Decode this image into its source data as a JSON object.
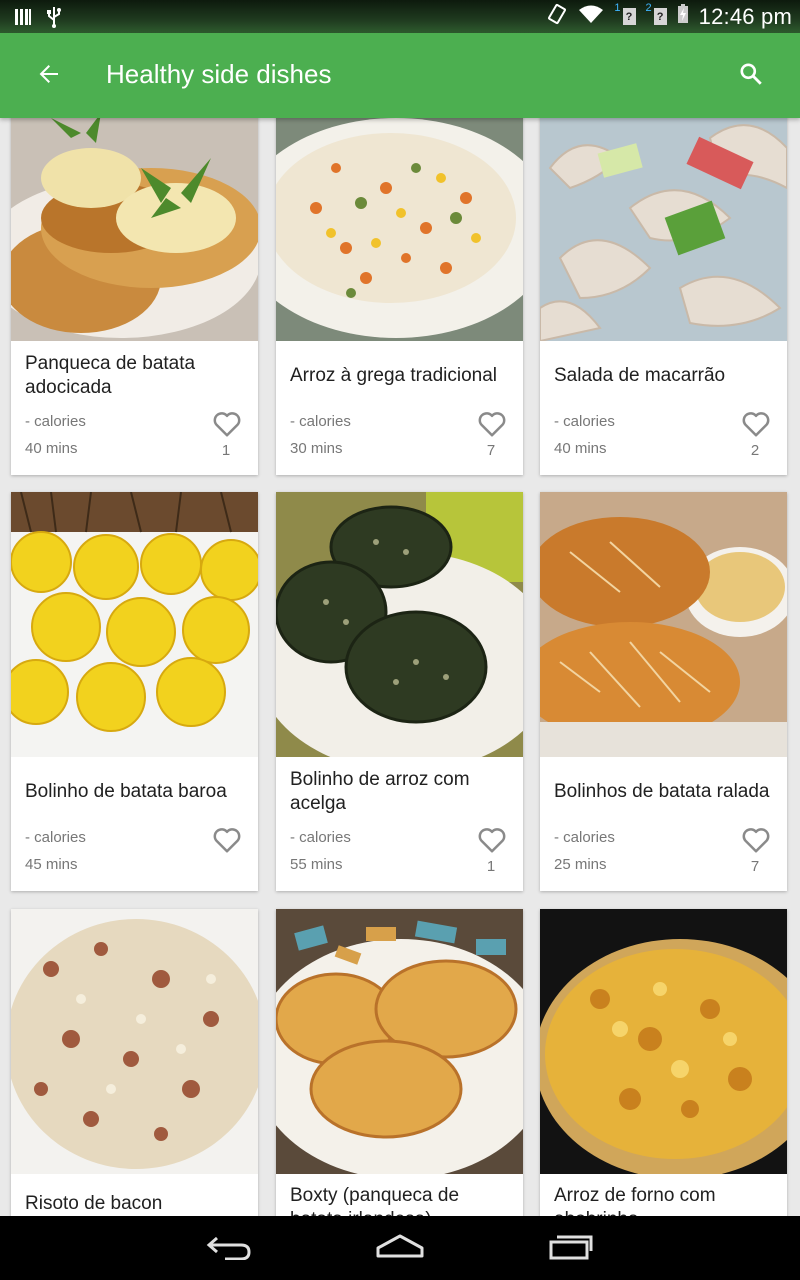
{
  "status_bar": {
    "time": "12:46 pm",
    "sim1": "1",
    "sim2": "2",
    "unknown": "?"
  },
  "app_bar": {
    "title": "Healthy side dishes",
    "back_icon": "arrow-back-icon",
    "search_icon": "search-icon"
  },
  "colors": {
    "primary": "#4caf50",
    "status_bar": "#1f3a1f",
    "card_bg": "#ffffff",
    "background": "#e9e9e9"
  },
  "recipes": [
    {
      "name": "Panqueca de batata adocicada",
      "calories": "- calories",
      "time": "40 mins",
      "likes": "1"
    },
    {
      "name": "Arroz à grega tradicional",
      "calories": "- calories",
      "time": "30 mins",
      "likes": "7"
    },
    {
      "name": "Salada de macarrão",
      "calories": "- calories",
      "time": "40 mins",
      "likes": "2"
    },
    {
      "name": "Bolinho de batata baroa",
      "calories": "- calories",
      "time": "45 mins",
      "likes": ""
    },
    {
      "name": "Bolinho de arroz com acelga",
      "calories": "- calories",
      "time": "55 mins",
      "likes": "1"
    },
    {
      "name": "Bolinhos de batata ralada",
      "calories": "- calories",
      "time": "25 mins",
      "likes": "7"
    },
    {
      "name": "Risoto de bacon"
    },
    {
      "name": "Boxty (panqueca de batata irlandesa)"
    },
    {
      "name": "Arroz de forno com abobrinha"
    }
  ]
}
